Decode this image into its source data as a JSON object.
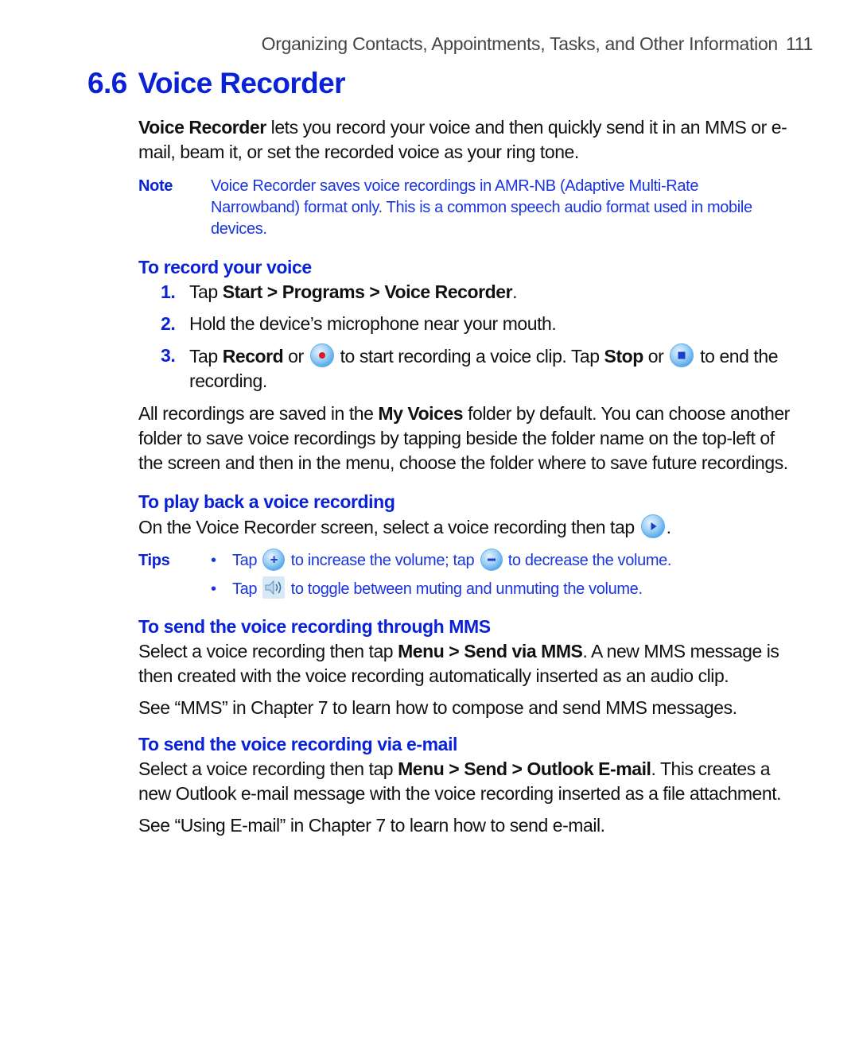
{
  "running_header": {
    "chapter_title": "Organizing Contacts, Appointments, Tasks, and Other Information",
    "page_number": "111"
  },
  "section": {
    "number": "6.6",
    "title": "Voice Recorder"
  },
  "intro": {
    "bold": "Voice Recorder",
    "text": " lets you record your voice and then quickly send it in an MMS or e-mail, beam it, or set the recorded voice as your ring tone."
  },
  "note": {
    "label": "Note",
    "text": "Voice Recorder saves voice recordings in AMR-NB (Adaptive Multi-Rate Narrowband) format only. This is a common speech audio format used in mobile devices."
  },
  "record": {
    "heading": "To record your voice",
    "steps": [
      {
        "num": "1.",
        "pre": "Tap ",
        "bold": "Start > Programs > Voice Recorder",
        "post": "."
      },
      {
        "num": "2.",
        "text": "Hold the device’s microphone near your mouth."
      },
      {
        "num": "3.",
        "pre": "Tap ",
        "bold1": "Record",
        "mid1": " or ",
        "icon1": "record-icon",
        "mid2": " to start recording a voice clip. Tap ",
        "bold2": "Stop",
        "mid3": " or ",
        "icon2": "stop-icon",
        "post": " to end the recording."
      }
    ],
    "folder_para": {
      "pre": "All recordings are saved in the ",
      "bold": "My Voices",
      "post": " folder by default. You can choose another folder to save voice recordings by tapping beside the folder name on the top-left of the screen and then in the menu, choose the folder where to save future recordings."
    }
  },
  "playback": {
    "heading": "To play back a voice recording",
    "text_pre": "On the Voice Recorder screen, select a voice recording then tap ",
    "icon": "play-icon",
    "text_post": ".",
    "tips": {
      "label": "Tips",
      "items": [
        {
          "bullet": "•",
          "pre": "Tap ",
          "icon1": "volume-up-icon",
          "mid": " to increase the volume; tap ",
          "icon2": "volume-down-icon",
          "post": " to decrease the volume."
        },
        {
          "bullet": "•",
          "pre": "Tap ",
          "icon": "speaker-mute-toggle-icon",
          "post": " to toggle between muting and unmuting the volume."
        }
      ]
    }
  },
  "mms": {
    "heading": "To send the voice recording through MMS",
    "pre": "Select a voice recording then tap ",
    "bold": "Menu > Send via MMS",
    "post": ". A new MMS message is then created with the voice recording automatically inserted as an audio clip.",
    "see_also": "See “MMS” in Chapter 7 to learn how to compose and send MMS messages."
  },
  "email": {
    "heading": "To send the voice recording via e-mail",
    "pre": "Select a voice recording then tap ",
    "bold": "Menu > Send > Outlook E-mail",
    "post": ". This creates a new Outlook e-mail message with the voice recording inserted as a file attachment.",
    "see_also": "See “Using E-mail” in Chapter 7 to learn how to send e-mail."
  },
  "colors": {
    "heading_blue": "#0a22d6",
    "note_blue": "#1a35e0",
    "body_text": "#111111",
    "header_gray": "#444444"
  }
}
